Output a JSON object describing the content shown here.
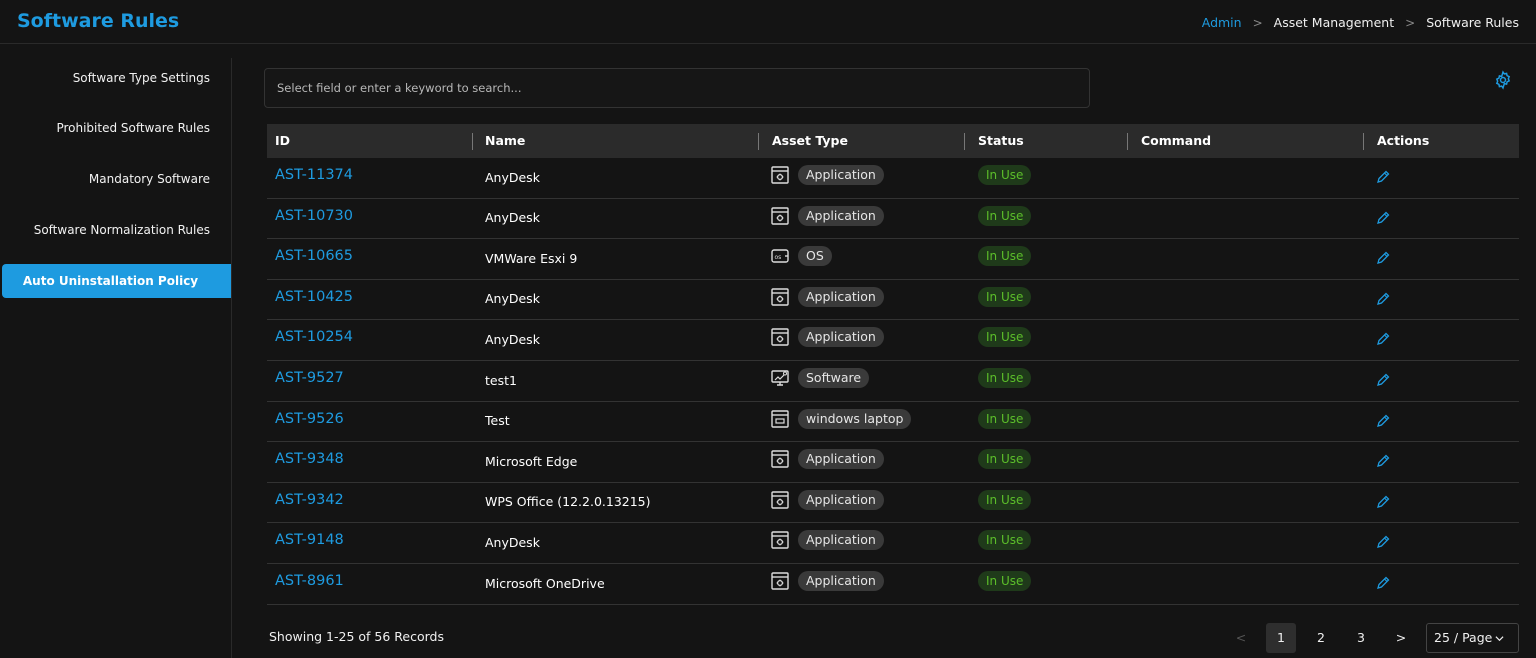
{
  "header": {
    "title": "Software Rules",
    "breadcrumb": [
      "Admin",
      "Asset Management",
      "Software Rules"
    ]
  },
  "sidebar": {
    "items": [
      {
        "label": "Software Type Settings",
        "active": false
      },
      {
        "label": "Prohibited Software Rules",
        "active": false
      },
      {
        "label": "Mandatory Software",
        "active": false
      },
      {
        "label": "Software Normalization Rules",
        "active": false
      },
      {
        "label": "Auto Uninstallation Policy",
        "active": true
      }
    ]
  },
  "search": {
    "placeholder": "Select field or enter a keyword to search..."
  },
  "table": {
    "columns": [
      "ID",
      "Name",
      "Asset Type",
      "Status",
      "Command",
      "Actions"
    ],
    "rows": [
      {
        "id": "AST-11374",
        "name": "AnyDesk",
        "asset_type": "Application",
        "asset_icon": "application-icon",
        "status": "In Use",
        "command": ""
      },
      {
        "id": "AST-10730",
        "name": "AnyDesk",
        "asset_type": "Application",
        "asset_icon": "application-icon",
        "status": "In Use",
        "command": ""
      },
      {
        "id": "AST-10665",
        "name": "VMWare Esxi 9",
        "asset_type": "OS",
        "asset_icon": "os-icon",
        "status": "In Use",
        "command": ""
      },
      {
        "id": "AST-10425",
        "name": "AnyDesk",
        "asset_type": "Application",
        "asset_icon": "application-icon",
        "status": "In Use",
        "command": ""
      },
      {
        "id": "AST-10254",
        "name": "AnyDesk",
        "asset_type": "Application",
        "asset_icon": "application-icon",
        "status": "In Use",
        "command": ""
      },
      {
        "id": "AST-9527",
        "name": "test1",
        "asset_type": "Software",
        "asset_icon": "software-icon",
        "status": "In Use",
        "command": ""
      },
      {
        "id": "AST-9526",
        "name": "Test",
        "asset_type": "windows laptop",
        "asset_icon": "window-icon",
        "status": "In Use",
        "command": ""
      },
      {
        "id": "AST-9348",
        "name": "Microsoft Edge",
        "asset_type": "Application",
        "asset_icon": "application-icon",
        "status": "In Use",
        "command": ""
      },
      {
        "id": "AST-9342",
        "name": "WPS Office (12.2.0.13215)",
        "asset_type": "Application",
        "asset_icon": "application-icon",
        "status": "In Use",
        "command": ""
      },
      {
        "id": "AST-9148",
        "name": "AnyDesk",
        "asset_type": "Application",
        "asset_icon": "application-icon",
        "status": "In Use",
        "command": ""
      },
      {
        "id": "AST-8961",
        "name": "Microsoft OneDrive",
        "asset_type": "Application",
        "asset_icon": "application-icon",
        "status": "In Use",
        "command": ""
      }
    ]
  },
  "footer": {
    "records_text": "Showing 1-25 of 56 Records",
    "pages": [
      "1",
      "2",
      "3"
    ],
    "current_page": "1",
    "page_size": "25 / Page"
  },
  "colors": {
    "accent": "#1e9be0",
    "status_text": "#5cbf2a",
    "status_bg": "#1f3a1a",
    "background": "#141414"
  }
}
